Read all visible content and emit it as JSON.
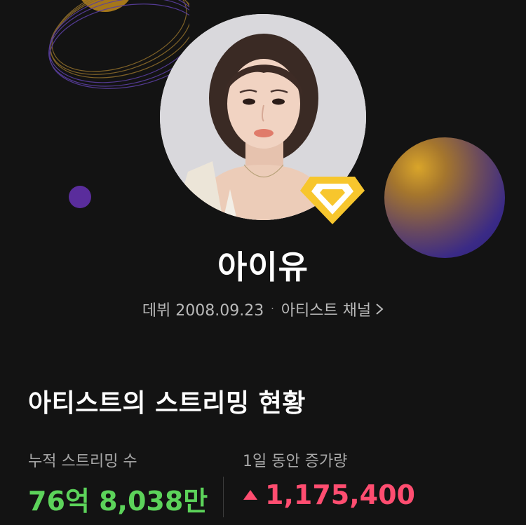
{
  "artist": {
    "name": "아이유",
    "debut": "데뷔 2008.09.23",
    "separator": "·",
    "channel_label": "아티스트 채널"
  },
  "section": {
    "title": "아티스트의 스트리밍 현황"
  },
  "stats": {
    "total_label": "누적 스트리밍 수",
    "total_value": "76억 8,038만",
    "daily_label": "1일 동안 증가량",
    "daily_value": "1,175,400"
  },
  "colors": {
    "background": "#131313",
    "total_value": "#5cd35a",
    "daily_value": "#ff4d70",
    "badge": "#f7c62d",
    "accent_purple": "#5a2d9c"
  },
  "icons": {
    "badge": "diamond-badge-icon",
    "channel_arrow": "chevron-right-icon",
    "increase": "triangle-up-icon"
  }
}
